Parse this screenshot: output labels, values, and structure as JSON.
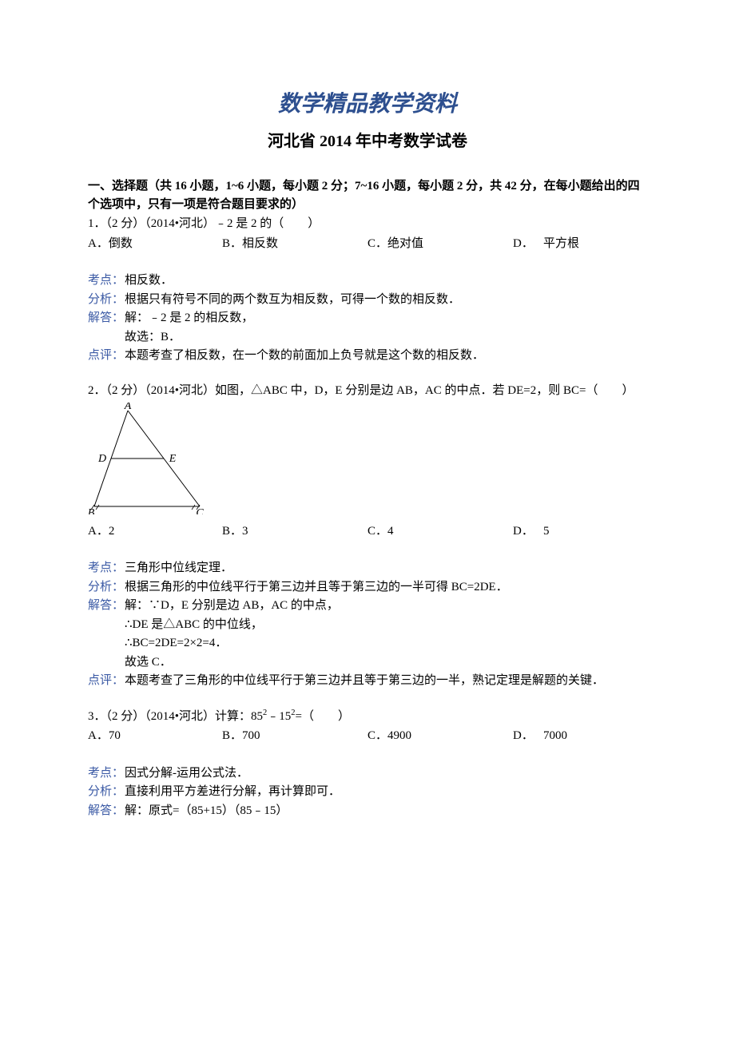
{
  "docTitle": "数学精品教学资料",
  "examTitle": "河北省 2014 年中考数学试卷",
  "sectionHeader": "一、选择题（共 16 小题，1~6 小题，每小题 2 分；7~16 小题，每小题 2 分，共 42 分，在每小题给出的四个选项中，只有一项是符合题目要求的）",
  "labels": {
    "kaodian": "考点：",
    "fenxi": "分析：",
    "jieda": "解答：",
    "dianping": "点评："
  },
  "q1": {
    "text": "1．（2 分）（2014•河北）﹣2 是 2 的（　　）",
    "A": "A．倒数",
    "B": "B．相反数",
    "C": "C．绝对值",
    "Dlabel": "D．",
    "Dval": "平方根",
    "kaodian": "相反数．",
    "fenxi": "根据只有符号不同的两个数互为相反数，可得一个数的相反数．",
    "jieda1": "解：﹣2 是 2 的相反数，",
    "jieda2": "故选：B．",
    "dianping": "本题考查了相反数，在一个数的前面加上负号就是这个数的相反数．"
  },
  "q2": {
    "text": "2．（2 分）（2014•河北）如图，△ABC 中，D，E 分别是边 AB，AC 的中点．若 DE=2，则 BC=（　　）",
    "A": "A．2",
    "B": "B．3",
    "C": "C．4",
    "Dlabel": "D．",
    "Dval": "5",
    "kaodian": "三角形中位线定理．",
    "fenxi": "根据三角形的中位线平行于第三边并且等于第三边的一半可得 BC=2DE．",
    "jieda1": "解：∵D，E 分别是边 AB，AC 的中点，",
    "jieda2": "∴DE 是△ABC 的中位线，",
    "jieda3": "∴BC=2DE=2×2=4．",
    "jieda4": "故选 C．",
    "dianping": "本题考查了三角形的中位线平行于第三边并且等于第三边的一半，熟记定理是解题的关键．"
  },
  "q3": {
    "textPrefix": "3．（2 分）（2014•河北）计算：85",
    "textMid": "﹣15",
    "textSuffix": "=（　　）",
    "A": "A．70",
    "B": "B．700",
    "C": "C．4900",
    "Dlabel": "D．",
    "Dval": "7000",
    "kaodian": "因式分解-运用公式法．",
    "fenxi": "直接利用平方差进行分解，再计算即可．",
    "jieda1": "解：原式=（85+15）（85﹣15）"
  }
}
